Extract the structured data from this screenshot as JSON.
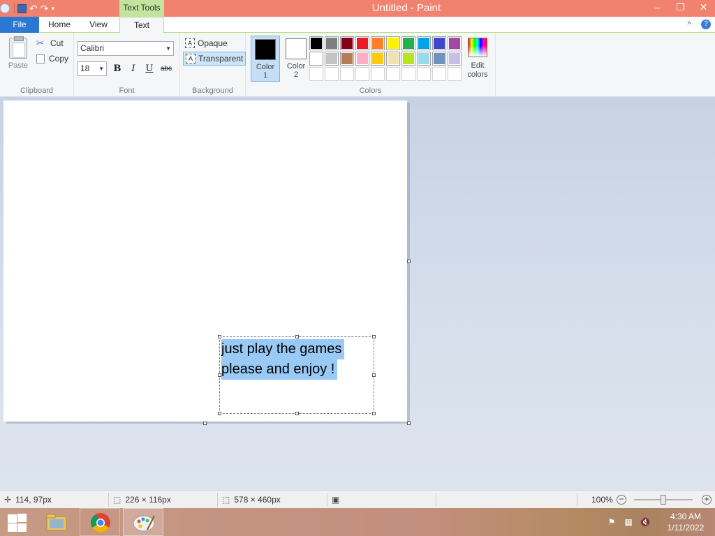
{
  "window": {
    "title": "Untitled - Paint",
    "context_tab": "Text Tools",
    "controls": {
      "minimize": "–",
      "restore": "❐",
      "close": "✕"
    }
  },
  "tabs": {
    "file": "File",
    "home": "Home",
    "view": "View",
    "text": "Text",
    "collapse": "^",
    "help": "?"
  },
  "clipboard": {
    "paste": "Paste",
    "cut": "Cut",
    "copy": "Copy",
    "group_label": "Clipboard"
  },
  "font": {
    "name": "Calibri",
    "size": "18",
    "bold": "B",
    "italic": "I",
    "underline": "U",
    "strike": "abc",
    "group_label": "Font"
  },
  "background": {
    "opaque": "Opaque",
    "transparent": "Transparent",
    "selected": "Transparent",
    "group_label": "Background"
  },
  "colors": {
    "color1_label": "Color 1",
    "color1_line1": "Color",
    "color1_line2": "1",
    "color2_line1": "Color",
    "color2_line2": "2",
    "color1": "#000000",
    "color2": "#ffffff",
    "edit_line1": "Edit",
    "edit_line2": "colors",
    "group_label": "Colors",
    "palette_row1": [
      "#000000",
      "#7f7f7f",
      "#880015",
      "#ed1c24",
      "#ff7f27",
      "#fff200",
      "#22b14c",
      "#00a2e8",
      "#3f48cc",
      "#a349a4"
    ],
    "palette_row2": [
      "#ffffff",
      "#c3c3c3",
      "#b97a57",
      "#ffaec9",
      "#ffc90e",
      "#efe4b0",
      "#b5e61d",
      "#99d9ea",
      "#7092be",
      "#c8bfe7"
    ]
  },
  "canvas": {
    "text_line1": "just play the games",
    "text_line2": "please and enjoy !"
  },
  "status": {
    "cursor_pos": "114, 97px",
    "selection_size": "226 × 116px",
    "image_size": "578 × 460px",
    "zoom": "100%"
  },
  "taskbar": {
    "time": "4:30 AM",
    "date": "1/11/2022",
    "apps": [
      "file-explorer",
      "chrome",
      "paint"
    ]
  }
}
